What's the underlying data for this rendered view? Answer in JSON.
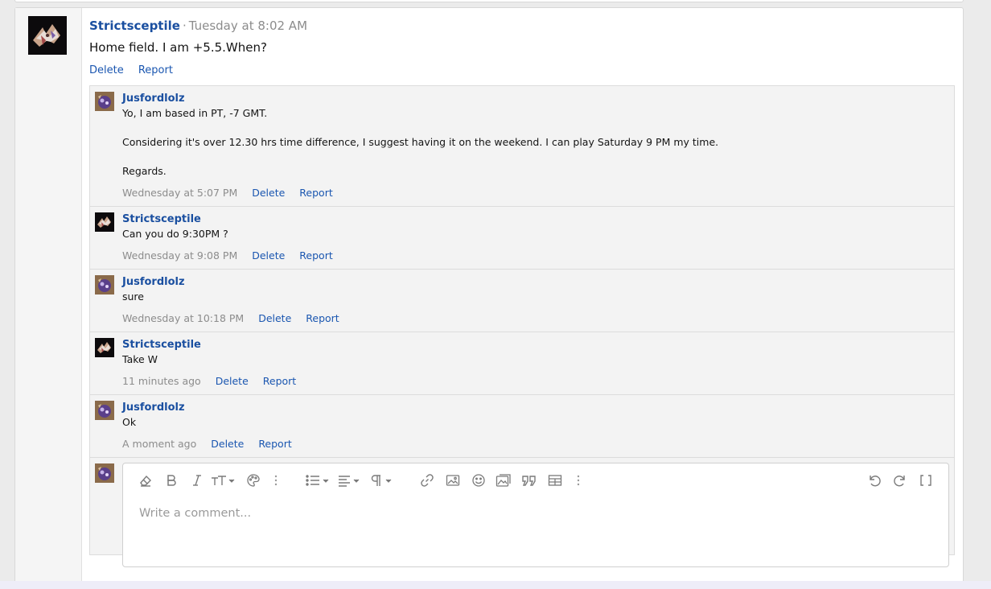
{
  "post": {
    "author": "Strictsceptile",
    "time": "Tuesday at 8:02 AM",
    "body": "Home field. I am +5.5.When?",
    "actions": [
      "Delete",
      "Report"
    ]
  },
  "comments": [
    {
      "author": "Jusfordlolz",
      "text": "Yo, I am based in PT, -7 GMT.\n\nConsidering it's over 12.30 hrs time difference, I suggest having it on the weekend. I can play Saturday 9 PM my time.\n\nRegards.",
      "date": "Wednesday at 5:07 PM",
      "delete_label": "Delete",
      "report_label": "Report"
    },
    {
      "author": "Strictsceptile",
      "text": "Can you do 9:30PM ?",
      "date": "Wednesday at 9:08 PM",
      "delete_label": "Delete",
      "report_label": "Report"
    },
    {
      "author": "Jusfordlolz",
      "text": "sure",
      "date": "Wednesday at 10:18 PM",
      "delete_label": "Delete",
      "report_label": "Report"
    },
    {
      "author": "Strictsceptile",
      "text": "Take W",
      "date": "11 minutes ago",
      "delete_label": "Delete",
      "report_label": "Report"
    },
    {
      "author": "Jusfordlolz",
      "text": "Ok",
      "date": "A moment ago",
      "delete_label": "Delete",
      "report_label": "Report"
    }
  ],
  "editor": {
    "placeholder": "Write a comment...",
    "toolbar": [
      "eraser-icon",
      "bold-icon",
      "italic-icon",
      "text-size-icon",
      "palette-icon",
      "more-vertical-icon",
      "list-icon",
      "align-icon",
      "paragraph-icon",
      "link-icon",
      "image-icon",
      "emoji-icon",
      "media-icon",
      "quote-icon",
      "table-icon",
      "more-vertical-icon",
      "undo-icon",
      "redo-icon",
      "fullscreen-icon"
    ]
  },
  "colors": {
    "link": "#1a56b0",
    "username": "#1a4fa0",
    "muted": "#8c8c8c"
  }
}
